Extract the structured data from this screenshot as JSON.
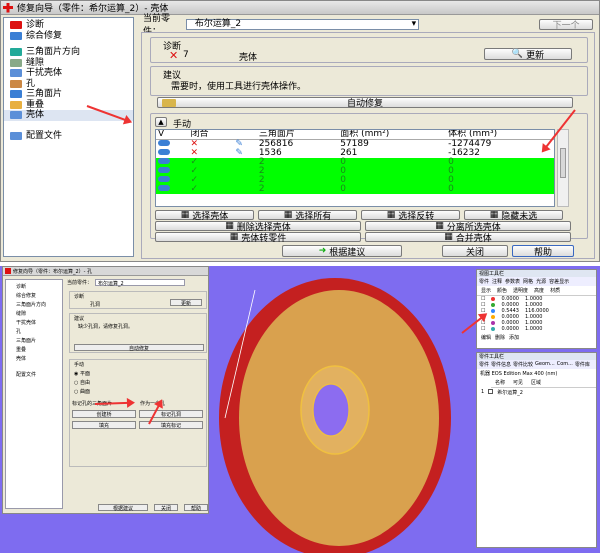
{
  "top": {
    "title": "修复向导（零件：希尔运算_2）- 壳体",
    "current_part_label": "当前零件：",
    "current_part_value": "布尔运算_2",
    "next_button": "下一个",
    "tree": [
      {
        "label": "诊断",
        "icon": "red-cross-icon"
      },
      {
        "label": "综合修复",
        "icon": "tools-icon"
      },
      {
        "label": "三角面片方向",
        "icon": "triangle-icon"
      },
      {
        "label": "缝隙",
        "icon": "gap-icon"
      },
      {
        "label": "干扰壳体",
        "icon": "shell-icon"
      },
      {
        "label": "孔",
        "icon": "hole-icon"
      },
      {
        "label": "三角面片",
        "icon": "triangle-icon"
      },
      {
        "label": "重叠",
        "icon": "overlap-icon"
      },
      {
        "label": "壳体",
        "icon": "shell-icon",
        "selected": true
      }
    ],
    "config_file": "配置文件",
    "diagnosis_label": "诊断",
    "diagnosis_count": "7",
    "diagnosis_item": "壳体",
    "update_button": "更新",
    "suggestion_label": "建议",
    "suggestion_text": "需要时，使用工具进行壳体操作。",
    "auto_fix_button": "自动修复",
    "manual_label": "手动",
    "table": {
      "headers": [
        "V",
        "闭合",
        "",
        "三角面片",
        "面积 (mm²)",
        "体积 (mm³)"
      ],
      "rows": [
        {
          "v": "",
          "closed": "✕",
          "triangles": "256816",
          "area": "57189",
          "volume": "-1274479",
          "green": false
        },
        {
          "v": "",
          "closed": "✕",
          "triangles": "1536",
          "area": "261",
          "volume": "-16232",
          "green": false
        },
        {
          "v": "",
          "closed": "✓",
          "triangles": "2",
          "area": "0",
          "volume": "0",
          "green": true
        },
        {
          "v": "",
          "closed": "✓",
          "triangles": "2",
          "area": "0",
          "volume": "0",
          "green": true
        },
        {
          "v": "",
          "closed": "✓",
          "triangles": "2",
          "area": "0",
          "volume": "0",
          "green": true
        },
        {
          "v": "",
          "closed": "✓",
          "triangles": "2",
          "area": "0",
          "volume": "0",
          "green": true
        }
      ]
    },
    "buttons_row1": [
      "选择壳体",
      "选择所有",
      "选择反转",
      "隐藏未选"
    ],
    "buttons_row2": [
      "删除选择壳体",
      "分离所选壳体"
    ],
    "buttons_row3": [
      "壳体转零件",
      "合并壳体"
    ],
    "footer": {
      "apply": "根据建议",
      "close": "关闭",
      "help": "帮助"
    }
  },
  "bottom": {
    "title": "修复向导（零件：布尔运算_2）- 孔",
    "current_part_label": "当前零件：",
    "current_part_value": "布尔运算_2",
    "tree": [
      "诊断",
      "综合修复",
      "三角面片方向",
      "缝隙",
      "干扰壳体",
      "孔",
      "三角面片",
      "重叠",
      "壳体"
    ],
    "config_file": "配置文件",
    "diag_label": "诊断",
    "diag_item": "孔洞",
    "update_button": "更新",
    "suggestion_label": "建议",
    "suggestion_text": "缺少孔洞，请修复孔洞。",
    "auto_fix_button": "自动修复",
    "manual_label": "手动",
    "radios": [
      "平面",
      "自由",
      "曲面"
    ],
    "chk1": "标记孔的三角面片",
    "chk2": "作为一个孔",
    "btns": [
      "创建桥",
      "标记孔洞",
      "填充",
      "填充标记"
    ],
    "footer": {
      "apply": "根据建议",
      "close": "关闭",
      "help": "帮助"
    },
    "rp_title": "视图工具栏",
    "rp_tabs": [
      "零件",
      "注释",
      "参数表",
      "网格",
      "光源",
      "容差显示"
    ],
    "rp_cols": [
      "显示",
      "颜色",
      "透明度",
      "高度",
      "材质"
    ],
    "rp_rows": [
      {
        "a": "0.0000",
        "b": "1.0000"
      },
      {
        "a": "0.0000",
        "b": "1.0000"
      },
      {
        "a": "0.5443",
        "b": "116.0000"
      },
      {
        "a": "0.0000",
        "b": "1.0000"
      },
      {
        "a": "0.0000",
        "b": "1.0000"
      },
      {
        "a": "0.0000",
        "b": "1.0000"
      }
    ],
    "rp_buttons": [
      "编辑",
      "删除",
      "添加"
    ],
    "rp2_title": "零件工具栏",
    "rp2_tabs": [
      "零件",
      "零件信息",
      "零件比较",
      "Geom...",
      "Com...",
      "零件库"
    ],
    "machine_label": "机器",
    "machine_value": "EOS Edition Max 400 (nm)",
    "part_cols": [
      "名称",
      "可见",
      "区域"
    ],
    "part_row": {
      "idx": "1",
      "name": "希尔运算_2"
    }
  },
  "colors": {
    "green": "#00ff00",
    "red_arrow": "#e33333",
    "purple_bg": "#7e6cf0",
    "disc": "#d9a14e",
    "disc_rim": "#cc2222"
  }
}
